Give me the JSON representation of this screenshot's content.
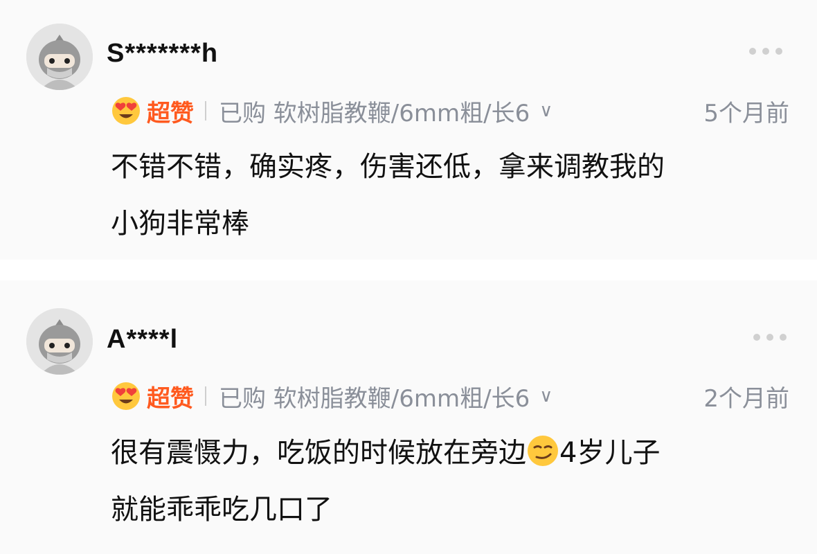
{
  "reviews": [
    {
      "username": "S*******h",
      "rating_label": "超赞",
      "rating_icon": "heart-eyes-emoji",
      "purchase_info": "已购 软树脂教鞭/6mm粗/长6",
      "time": "5个月前",
      "content_line1": "不错不错，确实疼，伤害还低，拿来调教我的",
      "content_line2": "小狗非常棒"
    },
    {
      "username": "A****l",
      "rating_label": "超赞",
      "rating_icon": "heart-eyes-emoji",
      "purchase_info": "已购 软树脂教鞭/6mm粗/长6",
      "time": "2个月前",
      "content_before_emoji": "很有震慑力，吃饭的时候放在旁边",
      "content_emoji": "smirk-emoji",
      "content_after_emoji": "4岁儿子",
      "content_line2": "就能乖乖吃几口了"
    }
  ],
  "icons": {
    "more": "more-dots-icon",
    "chevron": "chevron-down-icon",
    "avatar": "default-avatar"
  },
  "colors": {
    "rating_orange": "#ff5a1f",
    "meta_gray": "#8a8f99",
    "text_dark": "#111111"
  }
}
